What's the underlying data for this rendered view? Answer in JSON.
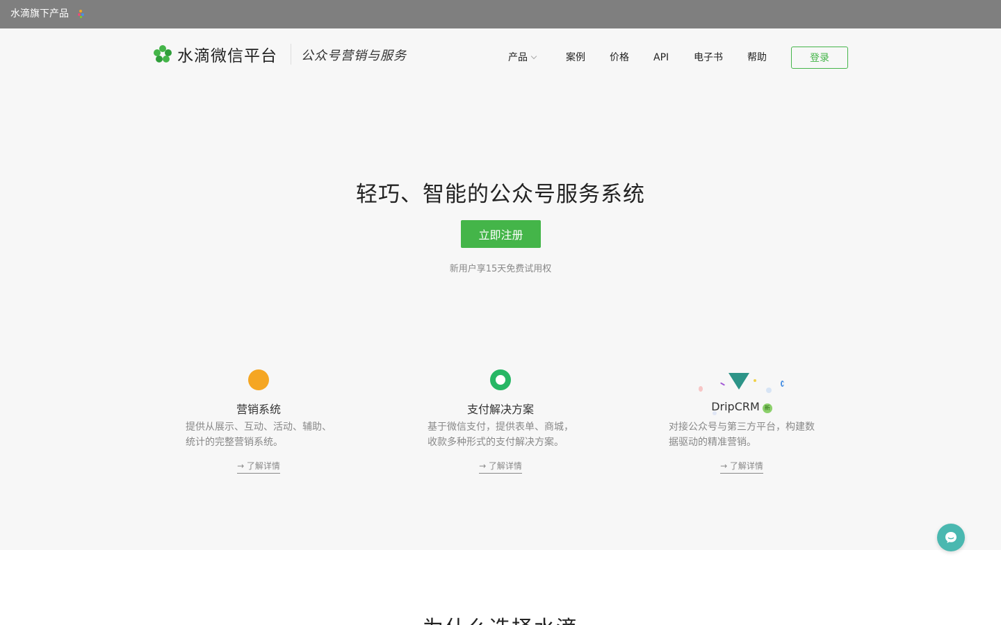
{
  "topbar": {
    "label": "水滴旗下产品"
  },
  "header": {
    "logo_text": "水滴微信平台",
    "slogan": "公众号营销与服务",
    "nav": {
      "products": "产品",
      "cases": "案例",
      "pricing": "价格",
      "api": "API",
      "ebook": "电子书",
      "help": "帮助"
    },
    "login": "登录"
  },
  "hero": {
    "title": "轻巧、智能的公众号服务系统",
    "register": "立即注册",
    "trial": "新用户享15天免费试用权"
  },
  "features": [
    {
      "title": "营销系统",
      "desc": "提供从展示、互动、活动、辅助、统计的完整营销系统。",
      "more": "→ 了解详情"
    },
    {
      "title": "支付解决方案",
      "desc": "基于微信支付，提供表单、商城，收款多种形式的支付解决方案。",
      "more": "→ 了解详情"
    },
    {
      "title": "DripCRM",
      "badge": "新",
      "desc": "对接公众号与第三方平台，构建数据驱动的精准营销。",
      "more": "→ 了解详情"
    }
  ],
  "why_title": "为什么选择水滴",
  "colors": {
    "brand_green": "#44b549",
    "topbar": "#7f7f7f",
    "chat": "#4ab8b0"
  }
}
